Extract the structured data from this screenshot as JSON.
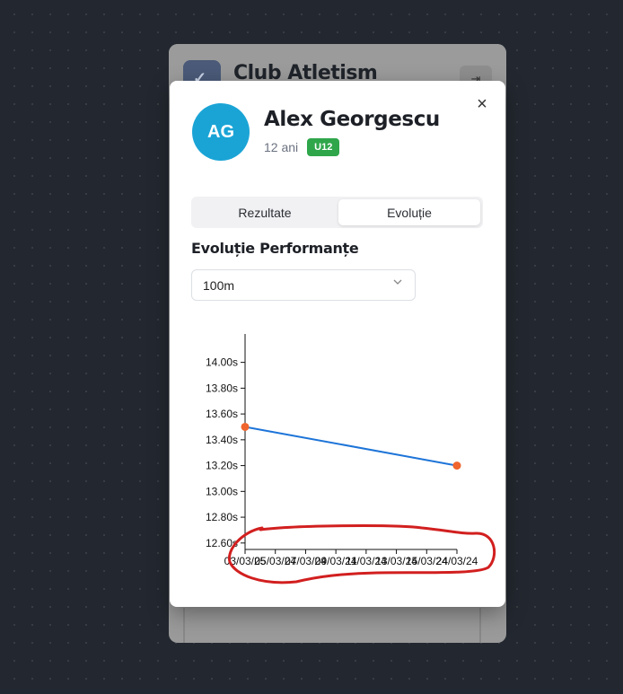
{
  "background_app": {
    "title": "Club Atletism",
    "logout_icon": "logout-icon"
  },
  "modal": {
    "close_icon": "close-icon",
    "athlete": {
      "initials": "AG",
      "name": "Alex Georgescu",
      "age": "12 ani",
      "category": "U12"
    },
    "tabs": [
      {
        "label": "Rezultate",
        "active": false
      },
      {
        "label": "Evoluție",
        "active": true
      }
    ],
    "section_title": "Evoluție Performanțe",
    "event_select": {
      "value": "100m"
    }
  },
  "colors": {
    "avatar": "#1aa4d6",
    "badge": "#2fa64a",
    "line": "#1d74d8",
    "point": "#f0642d",
    "annotation": "#d21f1f"
  },
  "chart_data": {
    "type": "line",
    "x": [
      "03/03/25",
      "24/03/24"
    ],
    "x_ticks": [
      "03/03/25",
      "05/03/24",
      "07/03/24",
      "09/03/24",
      "11/03/24",
      "13/03/24",
      "15/03/24",
      "24/03/24"
    ],
    "y_ticks": [
      "12.60s",
      "12.80s",
      "13.00s",
      "13.20s",
      "13.40s",
      "13.60s",
      "13.80s",
      "14.00s"
    ],
    "series": [
      {
        "values": [
          13.5,
          13.2
        ]
      }
    ],
    "ylim": [
      12.55,
      14.22
    ],
    "grid": false
  }
}
